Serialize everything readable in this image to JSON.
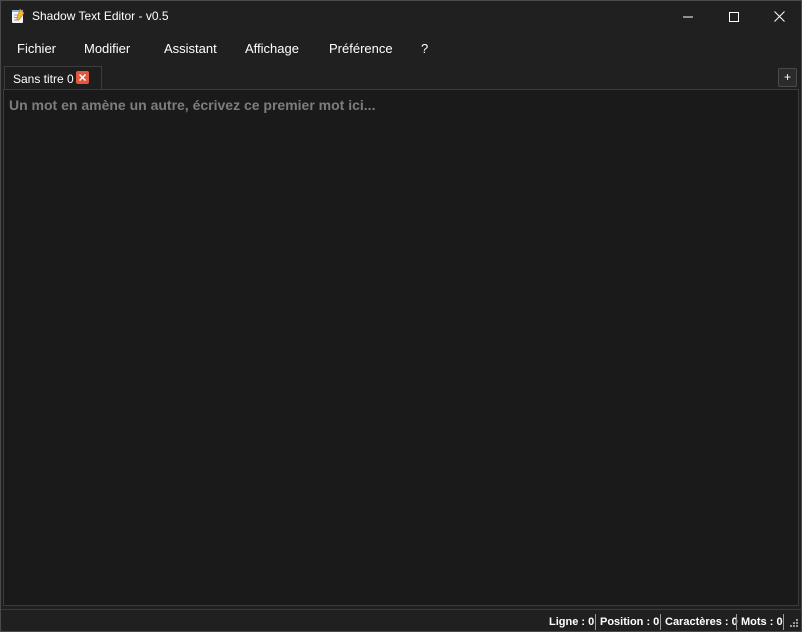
{
  "window": {
    "title": "Shadow Text Editor - v0.5",
    "app_icon": "notepad-icon",
    "controls": [
      "minimize-icon",
      "maximize-icon",
      "close-icon"
    ]
  },
  "menu": {
    "fichier": "Fichier",
    "modifier": "Modifier",
    "assistant": "Assistant",
    "affichage": "Affichage",
    "preference": "Préférence",
    "help": "?"
  },
  "tabs": [
    {
      "label": "Sans titre 0",
      "close_icon": "close-tab-icon"
    }
  ],
  "new_tab_label": "+",
  "editor": {
    "placeholder": "Un mot en amène un autre, écrivez ce premier mot ici..."
  },
  "status": {
    "line": "Ligne : 0",
    "position": "Position : 0",
    "chars": "Caractères : 0",
    "words": "Mots : 0"
  },
  "colors": {
    "window_bg": "#202020",
    "editor_bg": "#1a1a1a",
    "tab_close": "#e3573f",
    "placeholder_text": "#7d7d7d"
  }
}
